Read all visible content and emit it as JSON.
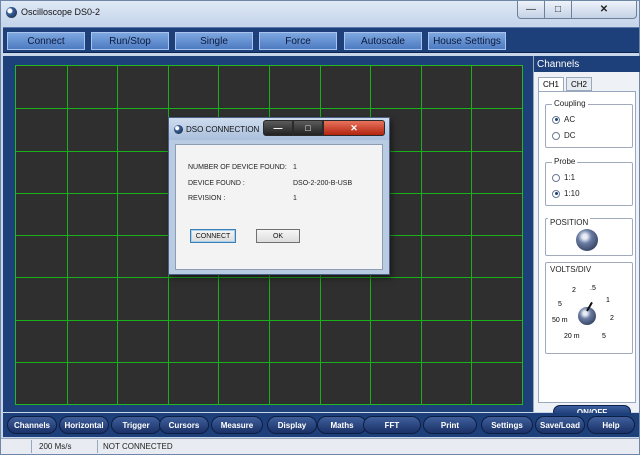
{
  "window": {
    "title": "Oscilloscope DS0-2",
    "min_glyph": "—",
    "max_glyph": "□",
    "close_glyph": "✕"
  },
  "toolbar_top": [
    {
      "label": "Connect"
    },
    {
      "label": "Run/Stop"
    },
    {
      "label": "Single"
    },
    {
      "label": "Force"
    },
    {
      "label": "Autoscale"
    },
    {
      "label": "House Settings"
    }
  ],
  "channels": {
    "header": "Channels",
    "tabs": [
      "CH1",
      "CH2"
    ],
    "active_tab": "CH1",
    "coupling": {
      "title": "Coupling",
      "options": [
        "AC",
        "DC"
      ],
      "selected": "AC"
    },
    "probe": {
      "title": "Probe",
      "options": [
        "1:1",
        "1:10"
      ],
      "selected": "1:10"
    },
    "position": {
      "title": "POSITION"
    },
    "volts_div": {
      "title": "VOLTS/DIV",
      "scale": [
        "2",
        ".5",
        "1",
        "5",
        "2",
        "50 m",
        "20 m",
        "5"
      ]
    },
    "onoff_label": "ON/OFF",
    "led_color": "#d80000"
  },
  "toolbar_bottom": [
    {
      "label": "Channels"
    },
    {
      "label": "Horizontal"
    },
    {
      "label": "Trigger"
    },
    {
      "label": "Cursors"
    },
    {
      "label": "Measure"
    },
    {
      "label": "Display"
    },
    {
      "label": "Maths"
    },
    {
      "label": "FFT"
    },
    {
      "label": "Print"
    },
    {
      "label": "Settings"
    },
    {
      "label": "Save/Load"
    },
    {
      "label": "Help"
    }
  ],
  "status": {
    "sample_rate": "200 Ms/s",
    "connection": "NOT CONNECTED"
  },
  "dialog": {
    "title": "DSO CONNECTION",
    "rows": [
      {
        "label": "NUMBER OF DEVICE  FOUND:",
        "value": "1"
      },
      {
        "label": "DEVICE FOUND :",
        "value": "DSO-2-200-B-USB"
      },
      {
        "label": "REVISION :",
        "value": "1"
      }
    ],
    "connect_label": "CONNECT",
    "ok_label": "OK"
  },
  "colors": {
    "grid": "#19b019",
    "screen_bg": "#2f2f2f",
    "toolbar_bg": "#1d3f7a"
  }
}
